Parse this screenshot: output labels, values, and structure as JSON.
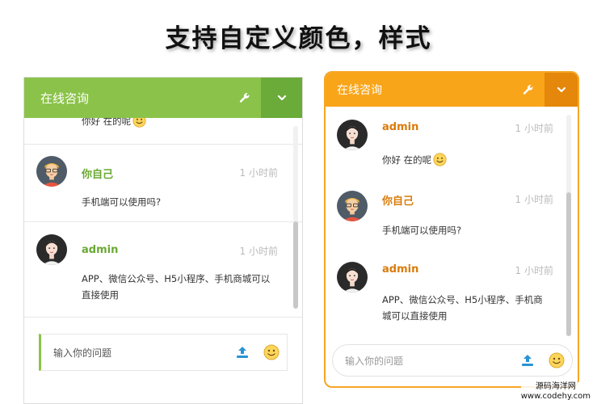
{
  "headline": "支持自定义颜色，样式",
  "colors": {
    "green": "#8bc34a",
    "green_dark": "#6aab3a",
    "orange": "#f9a51a",
    "orange_dark": "#e5870b"
  },
  "panel_green": {
    "title": "在线咨询",
    "messages": [
      {
        "name": "",
        "time": "",
        "text": "你好 在的呢",
        "avatar": "none",
        "emoji": true
      },
      {
        "name": "你自己",
        "time": "1 小时前",
        "text": "手机端可以使用吗?",
        "avatar": "cartoon-avatar",
        "emoji": false
      },
      {
        "name": "admin",
        "time": "1 小时前",
        "text": "APP、微信公众号、H5小程序、手机商城可以直接使用",
        "avatar": "woman-avatar",
        "emoji": false
      }
    ],
    "input_placeholder": "输入你的问题"
  },
  "panel_orange": {
    "title": "在线咨询",
    "messages": [
      {
        "name": "admin",
        "time": "1 小时前",
        "text": "你好 在的呢",
        "avatar": "woman-avatar",
        "emoji": true
      },
      {
        "name": "你自己",
        "time": "1 小时前",
        "text": "手机端可以使用吗?",
        "avatar": "cartoon-avatar",
        "emoji": false
      },
      {
        "name": "admin",
        "time": "1 小时前",
        "text": "APP、微信公众号、H5小程序、手机商城可以直接使用",
        "avatar": "woman-avatar",
        "emoji": false
      }
    ],
    "input_placeholder": "输入你的问题"
  },
  "watermark": {
    "name": "源码海洋网",
    "url": "www.codehy.com"
  }
}
